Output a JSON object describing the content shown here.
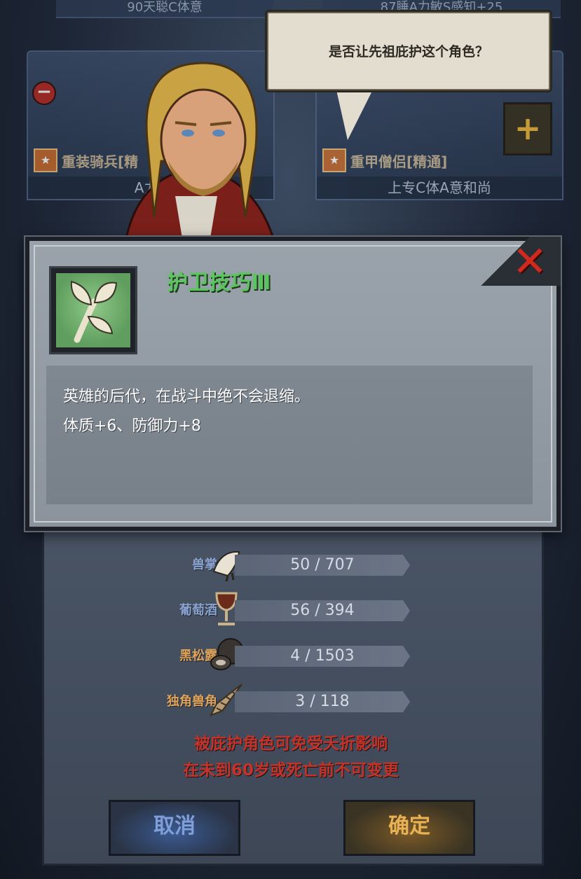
{
  "top_strips": {
    "left": "90天聪C体意",
    "right": "87睡A力敏S感知+25"
  },
  "cards": [
    {
      "name": "重装骑兵[精",
      "sub": "A力S"
    },
    {
      "name": "重甲僧侣[精通]",
      "sub": "上专C体A意和尚"
    }
  ],
  "buttons_small": {
    "minus": "−",
    "plus": "+"
  },
  "bubble": {
    "text": "是否让先祖庇护这个角色？"
  },
  "skill": {
    "title": "护卫技巧Ⅲ",
    "desc_line1": "英雄的后代，在战斗中绝不会退缩。",
    "desc_line2": "体质+6、防御力+8",
    "close": "✕"
  },
  "resources": [
    {
      "name": "兽掌",
      "value": "50 / 707",
      "color": "#8aa3cf",
      "icon": "beast-paw-icon"
    },
    {
      "name": "葡萄酒",
      "value": "56 / 394",
      "color": "#8aa3cf",
      "icon": "wine-goblet-icon"
    },
    {
      "name": "黑松露",
      "value": "4 / 1503",
      "color": "#e0a35a",
      "icon": "black-truffle-icon"
    },
    {
      "name": "独角兽角",
      "value": "3 / 118",
      "color": "#e0a35a",
      "icon": "unicorn-horn-icon"
    }
  ],
  "warnings": {
    "line1": "被庇护角色可免受夭折影响",
    "line2": "在未到60岁或死亡前不可变更"
  },
  "actions": {
    "cancel": "取消",
    "confirm": "确定"
  }
}
